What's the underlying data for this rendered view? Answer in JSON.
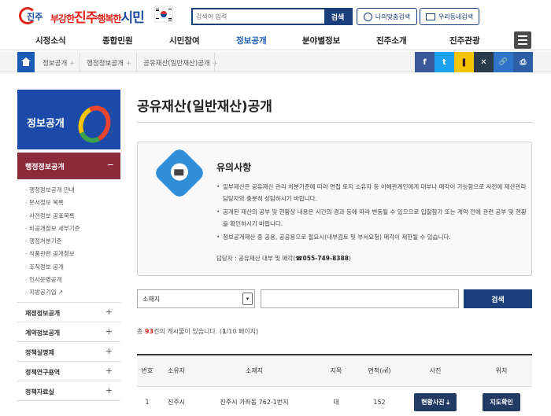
{
  "header": {
    "logo_text": "진주",
    "slogan": {
      "a": "부강한",
      "b": "진주",
      "c": "행복한",
      "d": "시민"
    },
    "search_placeholder": "검색어 입력",
    "search_button": "검색",
    "my_info_button": "나의맞춤검색",
    "news_button": "우리동네검색"
  },
  "gnb": [
    "시정소식",
    "종합민원",
    "시민참여",
    "정보공개",
    "분야별정보",
    "진주소개",
    "진주관광"
  ],
  "breadcrumb": [
    "정보공개",
    "행정정보공개",
    "공유재산(일반재산)공개"
  ],
  "share": {
    "facebook": "f",
    "twitter": "t",
    "kakao": "❚",
    "x": "✕",
    "link": "🔗",
    "print": "⎙"
  },
  "lnb": {
    "banner_title": "정보공개",
    "open_section": "행정정보공개",
    "open_sign": "−",
    "sub_items": [
      "행정정보공개 안내",
      "문서정보 목록",
      "사전정보 공표목록",
      "비공개정보 세부기준",
      "행정처분기준",
      "식품관련 공개정보",
      "조직정보 공개",
      "인사운영공개",
      "지방공기업 ↗"
    ],
    "categories": [
      "재정정보공개",
      "계약정보공개",
      "정책실명제",
      "정책연구용역",
      "정책자료실"
    ],
    "plus": "+"
  },
  "main": {
    "title": "공유재산(일반재산)공개",
    "notice_title": "유의사항",
    "notice_items": [
      "일부재산은 공유재산 관리 처분기준에 따라 연접 토지 소유자 등 이해관계인에게 대부나 매각이 가능함으로 사전에 재산관리담당자와 충분히 상담하시기 바랍니다.",
      "공개된 재산의 공부 및 현황상 내용은 시간의 경과 등에 따라 변동될 수 있으므로 입찰참가 또는 계약 전에 관련 공부 및 현황을 확인하시기 바랍니다.",
      "정보공개재산 중 공용, 공공용으로 필요시(내부검토 및 부서요청) 매각이 제한될 수 있습니다."
    ],
    "contact_label": "담당자 : 공유재산 대부 및 매각(",
    "contact_phone": "☎055-749-8388",
    "contact_end": ")",
    "select_value": "소재지",
    "select_arrow": "▾",
    "search_button": "검색",
    "count_pre": "총 ",
    "count_total": "93",
    "count_mid": "건의 게시물이 있습니다. (",
    "count_page": "1",
    "count_post": "/10 페이지)"
  },
  "table": {
    "headers": [
      "번호",
      "소유자",
      "소재지",
      "지목",
      "면적(㎡)",
      "사진",
      "위치"
    ],
    "rows": [
      [
        "1",
        "진주시",
        "진주시 가좌동 762-1번지",
        "대",
        "152",
        "현황사진 ⤓",
        "지도확인"
      ]
    ]
  }
}
